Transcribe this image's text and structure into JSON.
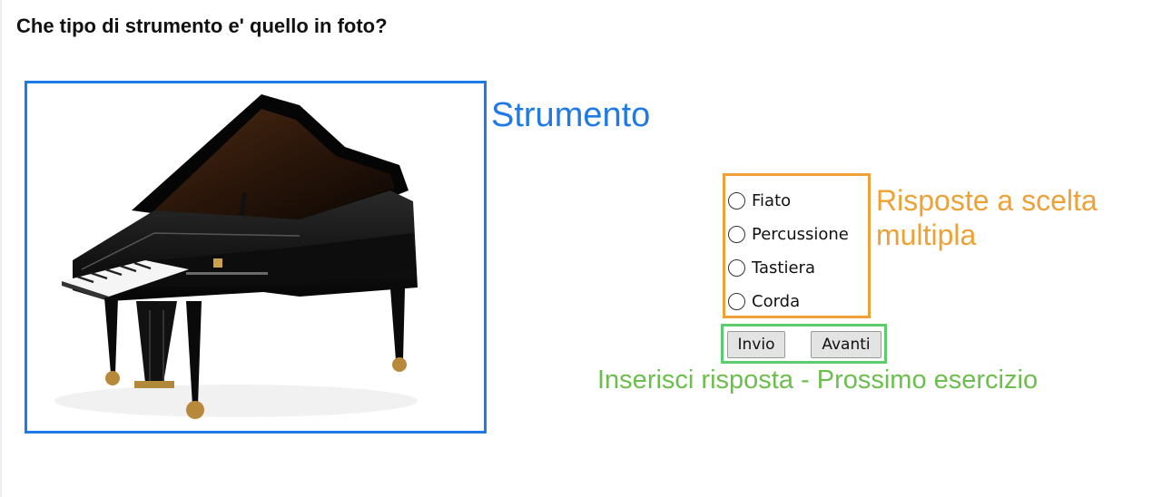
{
  "question": "Che tipo di strumento e' quello in foto?",
  "photo": {
    "subject": "grand-piano",
    "label": "Strumento",
    "label_color": "#1e7ae6"
  },
  "answers": {
    "options": [
      "Fiato",
      "Percussione",
      "Tastiera",
      "Corda"
    ],
    "label_line1": "Risposte a scelta",
    "label_line2": "multipla",
    "label_color": "#f0a135"
  },
  "buttons": {
    "submit_label": "Invio",
    "next_label": "Avanti",
    "caption": "Inserisci risposta - Prossimo esercizio",
    "caption_color": "#6cbf4e"
  }
}
